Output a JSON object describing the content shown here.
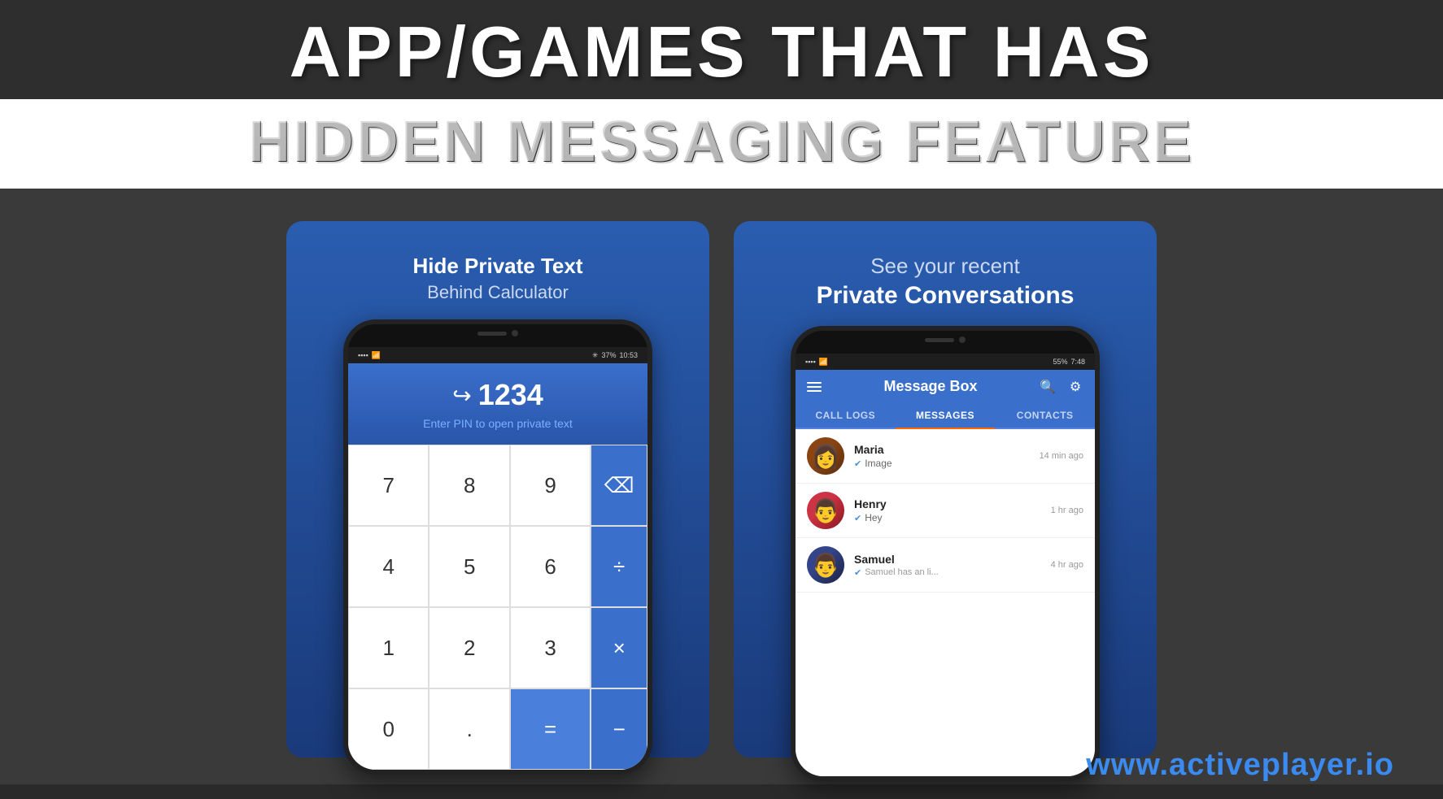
{
  "header": {
    "main_title": "APP/GAMES THAT HAS",
    "subtitle": "HIDDEN MESSAGING FEATURE"
  },
  "panel_left": {
    "label_bold": "Hide Private Text",
    "label_sub": "Behind Calculator",
    "status_bar": {
      "left": "WiFi 4G",
      "battery": "37%",
      "time": "10:53"
    },
    "display": {
      "pin": "1234",
      "hint": "Enter PIN to open private text"
    },
    "keys": [
      "7",
      "8",
      "9",
      "⌫",
      "4",
      "5",
      "6",
      "÷",
      "1",
      "2",
      "3",
      "×",
      "0",
      ".",
      "=",
      "−"
    ]
  },
  "panel_right": {
    "label_top": "See your recent",
    "label_bold": "Private Conversations",
    "status_bar": {
      "left": "WiFi 4G",
      "battery": "55%",
      "time": "7:48"
    },
    "app_title": "Message Box",
    "tabs": [
      "CALL LOGS",
      "MESSAGES",
      "CONTACTS"
    ],
    "active_tab": "MESSAGES",
    "messages": [
      {
        "name": "Maria",
        "preview": "Image",
        "time": "14 min ago",
        "avatar_color": "#8B4513"
      },
      {
        "name": "Henry",
        "preview": "Hey",
        "time": "1 hr ago",
        "avatar_color": "#cc3344"
      },
      {
        "name": "Samuel",
        "preview": "Samuel has an li...",
        "time": "4 hr ago",
        "avatar_color": "#334488"
      }
    ]
  },
  "watermark": "www.activeplayer.io",
  "accent_color": "#3a8af0"
}
